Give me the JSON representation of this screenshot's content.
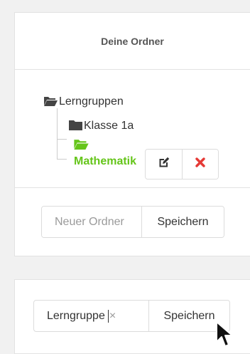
{
  "folders_panel": {
    "title": "Deine Ordner",
    "tree": {
      "root": "Lerngruppen",
      "child": "Klasse 1a",
      "active": "Mathematik"
    },
    "actions": {
      "edit_icon": "edit-icon",
      "delete_icon": "delete-icon"
    },
    "new_folder": {
      "placeholder": "Neuer Ordner",
      "save_label": "Speichern"
    }
  },
  "rename_panel": {
    "input_value": "Lerngruppe",
    "clear_symbol": "×",
    "save_label": "Speichern"
  },
  "colors": {
    "active_folder": "#65c51a",
    "delete": "#e53935"
  }
}
